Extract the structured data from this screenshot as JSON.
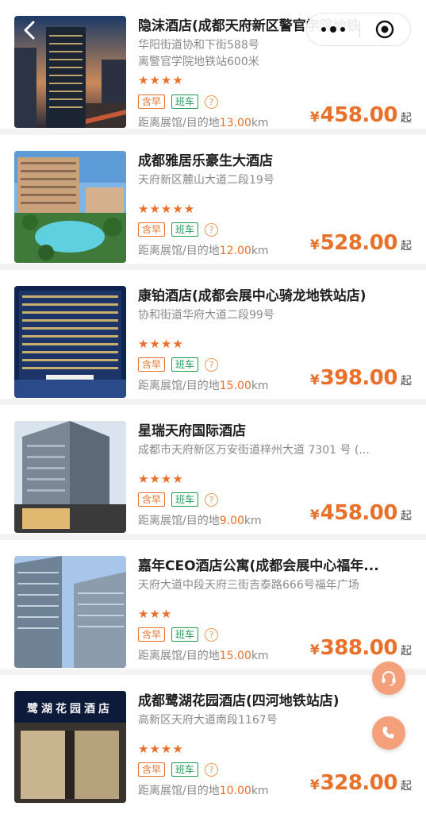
{
  "hotels": [
    {
      "name": "隐沫酒店(成都天府新区警官学院地铁",
      "address": "华阳街道协和下街588号",
      "address2": "离警官学院地铁站600米",
      "stars": "★★★★",
      "tag_breakfast": "含早",
      "tag_shuttle": "班车",
      "help": "?",
      "distance_label": "距离展馆/目的地",
      "distance_value": "13.00",
      "distance_unit": "km",
      "currency": "¥",
      "price": "458.00",
      "price_suffix": "起"
    },
    {
      "name": "成都雅居乐豪生大酒店",
      "address": "天府新区麓山大道二段19号",
      "stars": "★★★★★",
      "tag_breakfast": "含早",
      "tag_shuttle": "班车",
      "help": "?",
      "distance_label": "距离展馆/目的地",
      "distance_value": "12.00",
      "distance_unit": "km",
      "currency": "¥",
      "price": "528.00",
      "price_suffix": "起"
    },
    {
      "name": "康铂酒店(成都会展中心骑龙地铁站店)",
      "address": "协和街道华府大道二段99号",
      "stars": "★★★★",
      "tag_breakfast": "含早",
      "tag_shuttle": "班车",
      "help": "?",
      "distance_label": "距离展馆/目的地",
      "distance_value": "15.00",
      "distance_unit": "km",
      "currency": "¥",
      "price": "398.00",
      "price_suffix": "起"
    },
    {
      "name": "星瑞天府国际酒店",
      "address": "成都市天府新区万安街道梓州大道 7301 号 (...",
      "stars": "★★★★",
      "tag_breakfast": "含早",
      "tag_shuttle": "班车",
      "help": "?",
      "distance_label": "距离展馆/目的地",
      "distance_value": "9.00",
      "distance_unit": "km",
      "currency": "¥",
      "price": "458.00",
      "price_suffix": "起"
    },
    {
      "name": "嘉年CEO酒店公寓(成都会展中心福年...",
      "address": "天府大道中段天府三街吉泰路666号福年广场",
      "stars": "★★★",
      "tag_breakfast": "含早",
      "tag_shuttle": "班车",
      "help": "?",
      "distance_label": "距离展馆/目的地",
      "distance_value": "15.00",
      "distance_unit": "km",
      "currency": "¥",
      "price": "388.00",
      "price_suffix": "起"
    },
    {
      "name": "成都鹭湖花园酒店(四河地铁站店)",
      "address": "高新区天府大道南段1167号",
      "stars": "★★★★",
      "tag_breakfast": "含早",
      "tag_shuttle": "班车",
      "help": "?",
      "distance_label": "距离展馆/目的地",
      "distance_value": "10.00",
      "distance_unit": "km",
      "currency": "¥",
      "price": "328.00",
      "price_suffix": "起",
      "sign_text": "鹭湖花园酒店"
    }
  ],
  "colors": {
    "accent": "#e8702a",
    "tag_green": "#1f9d55",
    "fab": "#f4a07a"
  },
  "icons": {
    "back": "chevron-left-icon",
    "more": "more-dots-icon",
    "close": "target-circle-icon",
    "service": "customer-service-icon",
    "phone": "phone-icon"
  }
}
